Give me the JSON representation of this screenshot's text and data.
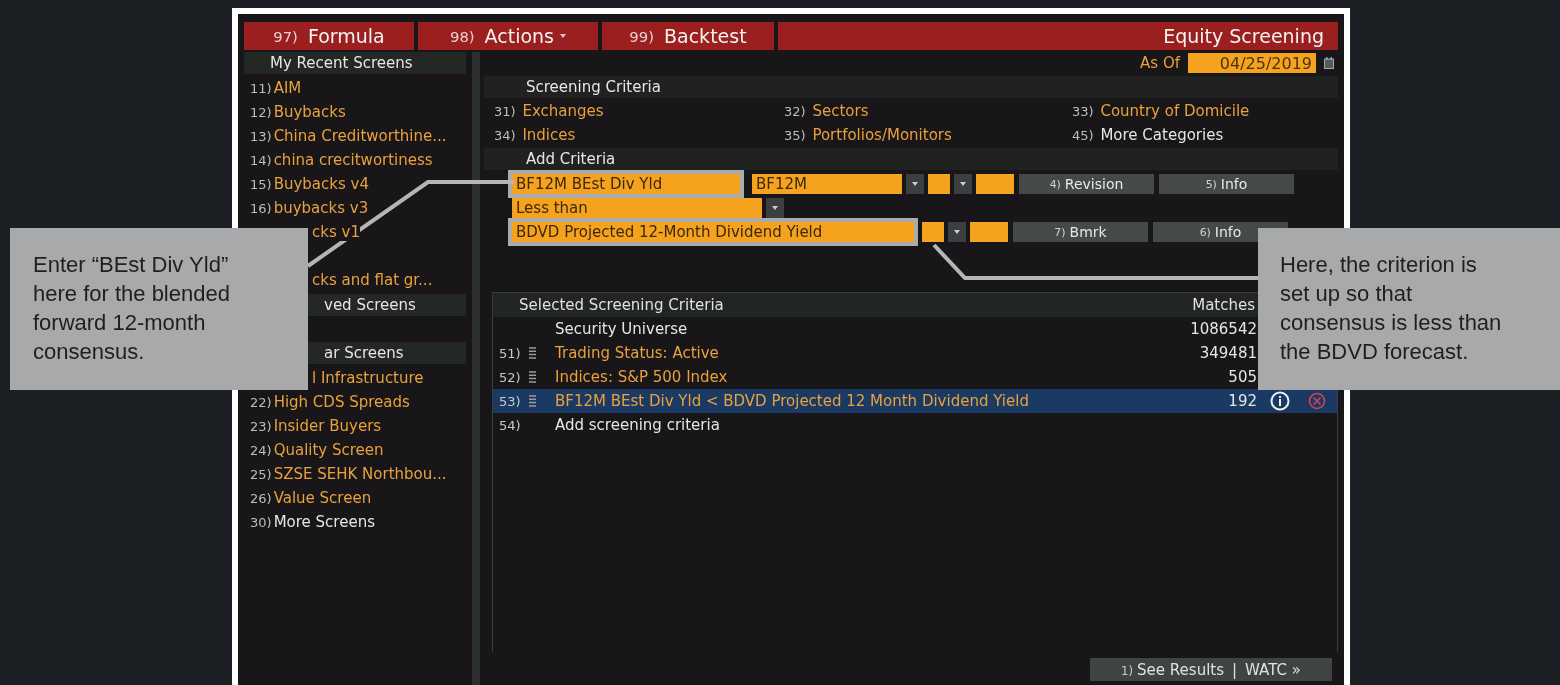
{
  "toolbar": {
    "tabs": [
      {
        "number": "97)",
        "label": "Formula",
        "dropdown": false
      },
      {
        "number": "98)",
        "label": "Actions",
        "dropdown": true
      },
      {
        "number": "99)",
        "label": "Backtest",
        "dropdown": false
      }
    ],
    "title": "Equity Screening"
  },
  "sidebar": {
    "items": [
      {
        "kind": "header",
        "label": "My Recent Screens"
      },
      {
        "kind": "link",
        "number": "11)",
        "label": "AIM"
      },
      {
        "kind": "link",
        "number": "12)",
        "label": "Buybacks"
      },
      {
        "kind": "link",
        "number": "13)",
        "label": "China Creditworthine..."
      },
      {
        "kind": "link",
        "number": "14)",
        "label": "china crecitwortiness"
      },
      {
        "kind": "link",
        "number": "15)",
        "label": "Buybacks v4"
      },
      {
        "kind": "link",
        "number": "16)",
        "label": "buybacks v3"
      },
      {
        "kind": "clipped",
        "label": "cks v1"
      },
      {
        "kind": "clipped",
        "label": "cks and flat gr..."
      },
      {
        "kind": "clipped-header",
        "label": "ved Screens"
      },
      {
        "kind": "clipped-header",
        "label": "ar Screens"
      },
      {
        "kind": "clipped",
        "label": "l Infrastructure"
      },
      {
        "kind": "link",
        "number": "22)",
        "label": "High CDS Spreads"
      },
      {
        "kind": "link",
        "number": "23)",
        "label": "Insider Buyers"
      },
      {
        "kind": "link",
        "number": "24)",
        "label": "Quality Screen"
      },
      {
        "kind": "link",
        "number": "25)",
        "label": "SZSE SEHK Northbou..."
      },
      {
        "kind": "link",
        "number": "26)",
        "label": "Value Screen"
      },
      {
        "kind": "more",
        "number": "30)",
        "label": "More Screens"
      }
    ]
  },
  "as_of": {
    "label": "As Of",
    "value": "04/25/2019"
  },
  "screening_criteria": {
    "title": "Screening Criteria",
    "categories": [
      {
        "kind": "link",
        "number": "31)",
        "label": "Exchanges"
      },
      {
        "kind": "link",
        "number": "32)",
        "label": "Sectors"
      },
      {
        "kind": "link",
        "number": "33)",
        "label": "Country of Domicile"
      },
      {
        "kind": "link",
        "number": "34)",
        "label": "Indices"
      },
      {
        "kind": "link",
        "number": "35)",
        "label": "Portfolios/Monitors"
      },
      {
        "kind": "more",
        "number": "45)",
        "label": "More Categories"
      }
    ]
  },
  "add_criteria": {
    "title": "Add Criteria",
    "field": {
      "value": "BF12M BEst Div Yld",
      "highlighted": true
    },
    "source": {
      "value": "BF12M"
    },
    "field_buttons": [
      {
        "number": "4)",
        "label": "Revision"
      },
      {
        "number": "5)",
        "label": "Info"
      }
    ],
    "operator": {
      "value": "Less than"
    },
    "compare": {
      "value": "BDVD Projected 12-Month Dividend Yield",
      "highlighted": true
    },
    "compare_buttons": [
      {
        "number": "7)",
        "label": "Bmrk"
      },
      {
        "number": "6)",
        "label": "Info"
      }
    ]
  },
  "selected_criteria": {
    "title": "Selected Screening Criteria",
    "matches_header": "Matches",
    "rows": [
      {
        "kind": "universe",
        "label": "Security Universe",
        "matches": "1086542",
        "selected": false
      },
      {
        "kind": "criterion",
        "number": "51)",
        "label": "Trading Status: Active",
        "matches": "349481",
        "selected": false
      },
      {
        "kind": "criterion",
        "number": "52)",
        "label": "Indices: S&P 500 Index",
        "matches": "505",
        "selected": false
      },
      {
        "kind": "criterion",
        "number": "53)",
        "label": "BF12M BEst Div Yld < BDVD Projected 12 Month Dividend Yield",
        "matches": "192",
        "selected": true
      },
      {
        "kind": "add",
        "number": "54)",
        "label": "Add screening criteria",
        "selected": false
      }
    ]
  },
  "footer_button": {
    "number": "1)",
    "label": "See Results",
    "divider": "|",
    "link": "WATC »"
  },
  "callouts": [
    {
      "text": "Enter “BEst Div Yld” here for the blended forward 12-month consensus."
    },
    {
      "text": "Here, the criterion is set up so that consensus is less than the BDVD forecast."
    }
  ]
}
